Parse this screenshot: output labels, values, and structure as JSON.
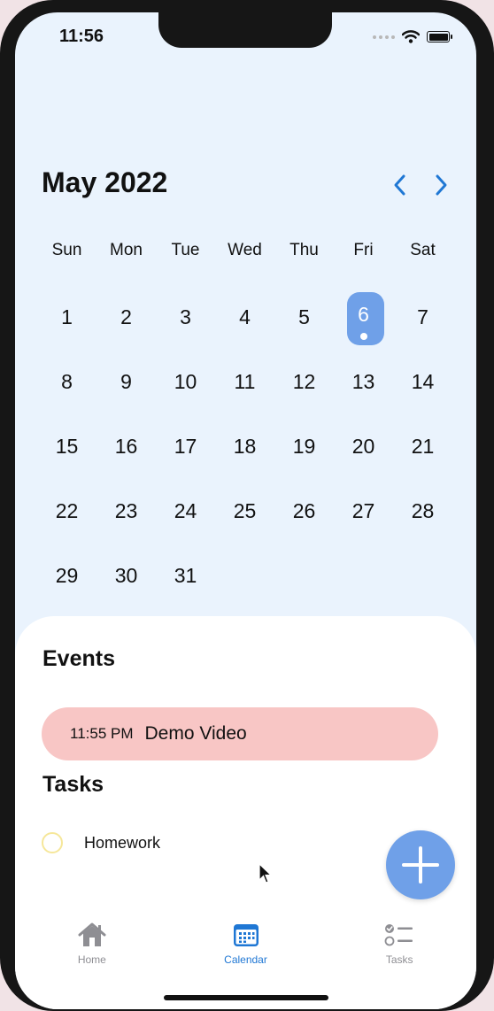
{
  "status_bar": {
    "time": "11:56"
  },
  "calendar": {
    "month_title": "May 2022",
    "weekdays": [
      "Sun",
      "Mon",
      "Tue",
      "Wed",
      "Thu",
      "Fri",
      "Sat"
    ],
    "weeks": [
      [
        "1",
        "2",
        "3",
        "4",
        "5",
        "6",
        "7"
      ],
      [
        "8",
        "9",
        "10",
        "11",
        "12",
        "13",
        "14"
      ],
      [
        "15",
        "16",
        "17",
        "18",
        "19",
        "20",
        "21"
      ],
      [
        "22",
        "23",
        "24",
        "25",
        "26",
        "27",
        "28"
      ],
      [
        "29",
        "30",
        "31",
        "",
        "",
        "",
        ""
      ]
    ],
    "selected_day": "6",
    "accent_color": "#6fa0e8"
  },
  "events": {
    "title": "Events",
    "items": [
      {
        "time": "11:55 PM",
        "name": "Demo Video",
        "color": "#f8c6c5"
      }
    ]
  },
  "tasks": {
    "title": "Tasks",
    "items": [
      {
        "label": "Homework",
        "done": false
      }
    ]
  },
  "tab_bar": {
    "items": [
      {
        "label": "Home",
        "icon": "house-icon",
        "active": false
      },
      {
        "label": "Calendar",
        "icon": "calendar-icon",
        "active": true
      },
      {
        "label": "Tasks",
        "icon": "checklist-icon",
        "active": false
      }
    ]
  }
}
